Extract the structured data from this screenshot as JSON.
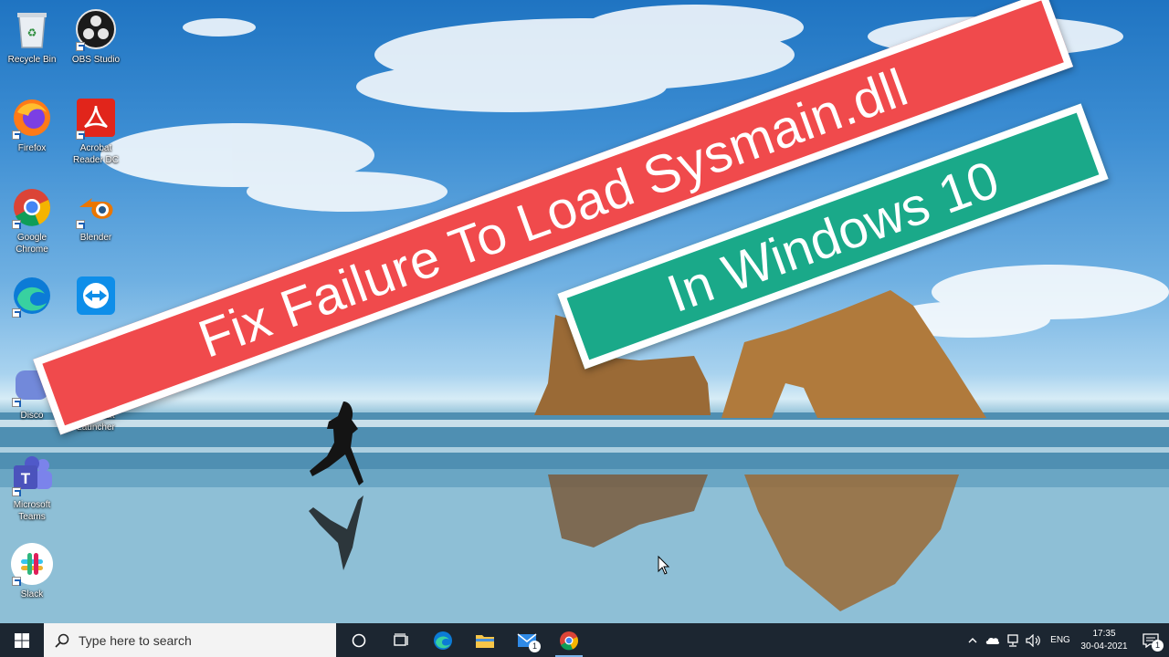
{
  "desktop": {
    "icons": [
      {
        "label": "Recycle Bin",
        "icon": "recycle-bin-icon"
      },
      {
        "label": "OBS Studio",
        "icon": "obs-icon"
      },
      {
        "label": "Firefox",
        "icon": "firefox-icon"
      },
      {
        "label": "Acrobat\nReader DC",
        "icon": "acrobat-icon"
      },
      {
        "label": "Google\nChrome",
        "icon": "chrome-icon"
      },
      {
        "label": "Blender",
        "icon": "blender-icon"
      },
      {
        "label": "",
        "icon": "edge-icon"
      },
      {
        "label": "",
        "icon": "teamviewer-icon"
      },
      {
        "label": "Disco",
        "icon": "discord-icon"
      },
      {
        "label": "Minecraft\nLauncher",
        "icon": "minecraft-icon"
      },
      {
        "label": "Microsoft\nTeams",
        "icon": "teams-icon"
      },
      {
        "label": "Slack",
        "icon": "slack-icon"
      }
    ]
  },
  "banner": {
    "title": "Fix Failure To Load Sysmain.dll",
    "subtitle": "In Windows 10",
    "title_color": "#f04a4c",
    "subtitle_color": "#1aa989"
  },
  "taskbar": {
    "search_placeholder": "Type here to search",
    "mail_badge": "1",
    "tray": {
      "language": "ENG",
      "time": "17:35",
      "date": "30-04-2021",
      "notification_count": "1"
    }
  }
}
